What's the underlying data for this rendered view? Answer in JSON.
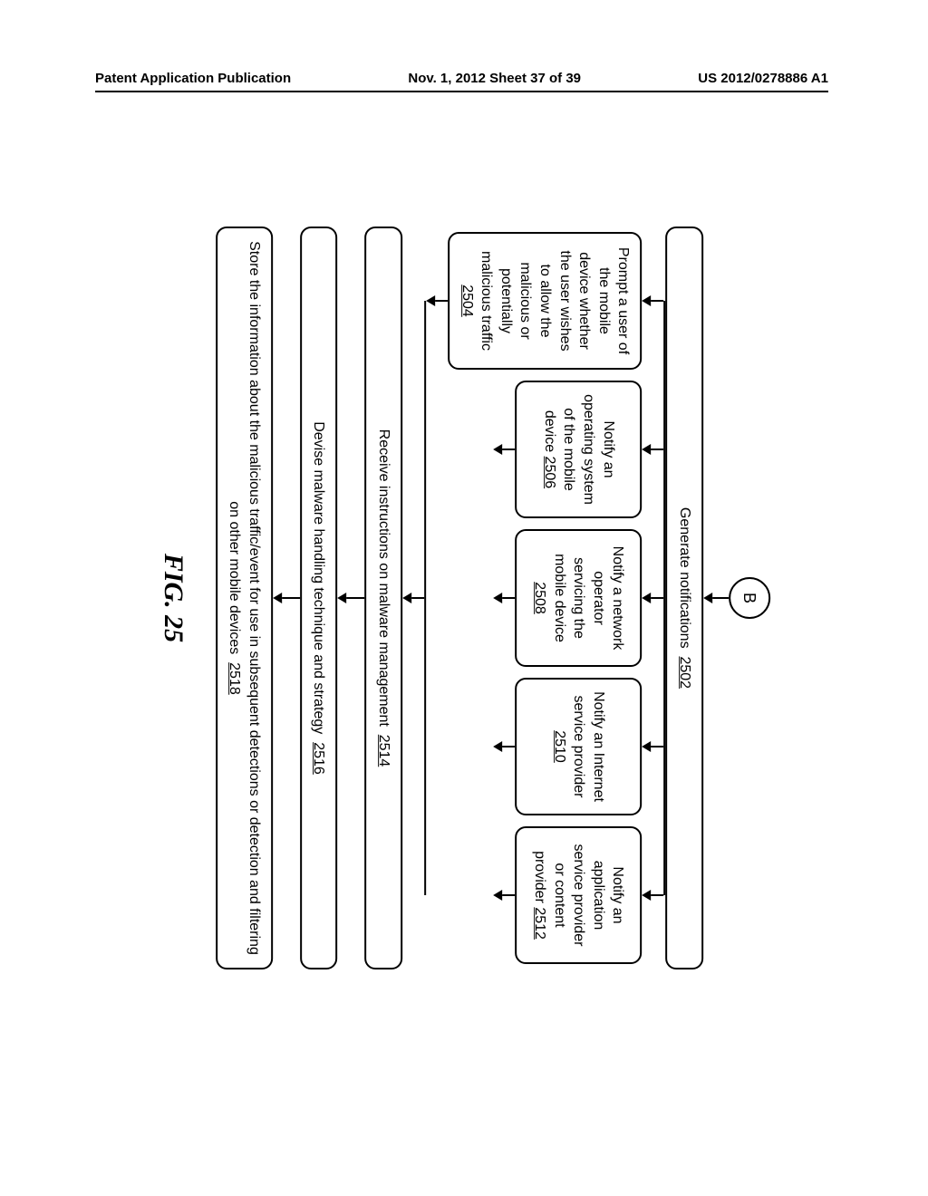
{
  "header": {
    "left": "Patent Application Publication",
    "center": "Nov. 1, 2012  Sheet 37 of 39",
    "right": "US 2012/0278886 A1"
  },
  "connector": "B",
  "box2502": {
    "text": "Generate notifications",
    "ref": "2502"
  },
  "branches": [
    {
      "text": "Prompt a user of the mobile device whether the user wishes to allow the malicious or potentially malicious traffic",
      "ref": "2504"
    },
    {
      "text": "Notify an operating system of the mobile device",
      "ref": "2506"
    },
    {
      "text": "Notify a network operator servicing the mobile device",
      "ref": "2508"
    },
    {
      "text": "Notify an Internet service provider",
      "ref": "2510"
    },
    {
      "text": "Notify an application service provider or content provider",
      "ref": "2512"
    }
  ],
  "box2514": {
    "text": "Receive instructions on malware management",
    "ref": "2514"
  },
  "box2516": {
    "text": "Devise malware handling technique and strategy",
    "ref": "2516"
  },
  "box2518": {
    "text": "Store the information about the malicious traffic/event for use in subsequent detections or detection and filtering on other mobile devices",
    "ref": "2518"
  },
  "figure": "FIG. 25"
}
